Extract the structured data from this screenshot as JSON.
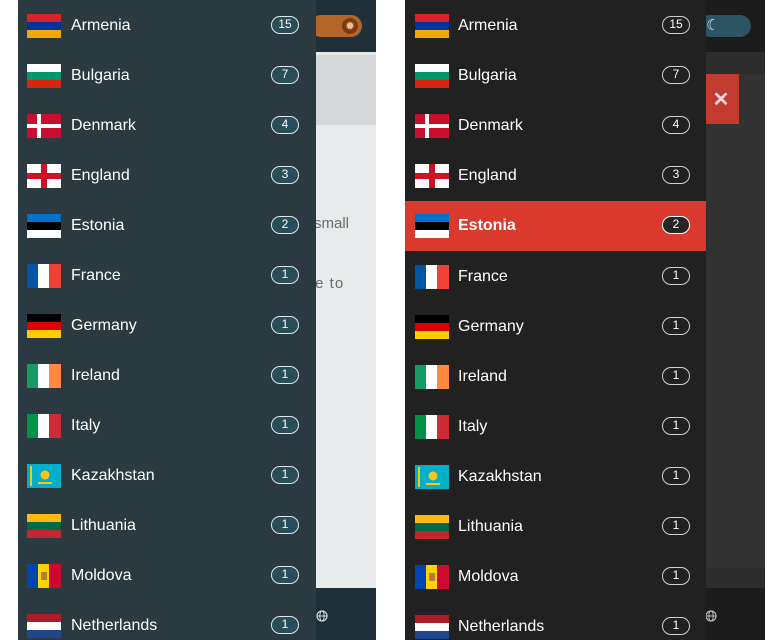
{
  "left_panel": {
    "theme": "teal",
    "background_text": {
      "line1": "small",
      "line2": "te to"
    },
    "countries": [
      {
        "name": "Armenia",
        "count": "15",
        "flag": "armenia"
      },
      {
        "name": "Bulgaria",
        "count": "7",
        "flag": "bulgaria"
      },
      {
        "name": "Denmark",
        "count": "4",
        "flag": "denmark"
      },
      {
        "name": "England",
        "count": "3",
        "flag": "england"
      },
      {
        "name": "Estonia",
        "count": "2",
        "flag": "estonia"
      },
      {
        "name": "France",
        "count": "1",
        "flag": "france"
      },
      {
        "name": "Germany",
        "count": "1",
        "flag": "germany"
      },
      {
        "name": "Ireland",
        "count": "1",
        "flag": "ireland"
      },
      {
        "name": "Italy",
        "count": "1",
        "flag": "italy"
      },
      {
        "name": "Kazakhstan",
        "count": "1",
        "flag": "kazakhstan"
      },
      {
        "name": "Lithuania",
        "count": "1",
        "flag": "lithuania"
      },
      {
        "name": "Moldova",
        "count": "1",
        "flag": "moldova"
      },
      {
        "name": "Netherlands",
        "count": "1",
        "flag": "netherlands"
      }
    ]
  },
  "right_panel": {
    "theme": "dark",
    "selected": "Estonia",
    "close_glyph": "✕",
    "countries": [
      {
        "name": "Armenia",
        "count": "15",
        "flag": "armenia"
      },
      {
        "name": "Bulgaria",
        "count": "7",
        "flag": "bulgaria"
      },
      {
        "name": "Denmark",
        "count": "4",
        "flag": "denmark"
      },
      {
        "name": "England",
        "count": "3",
        "flag": "england"
      },
      {
        "name": "Estonia",
        "count": "2",
        "flag": "estonia"
      },
      {
        "name": "France",
        "count": "1",
        "flag": "france"
      },
      {
        "name": "Germany",
        "count": "1",
        "flag": "germany"
      },
      {
        "name": "Ireland",
        "count": "1",
        "flag": "ireland"
      },
      {
        "name": "Italy",
        "count": "1",
        "flag": "italy"
      },
      {
        "name": "Kazakhstan",
        "count": "1",
        "flag": "kazakhstan"
      },
      {
        "name": "Lithuania",
        "count": "1",
        "flag": "lithuania"
      },
      {
        "name": "Moldova",
        "count": "1",
        "flag": "moldova"
      },
      {
        "name": "Netherlands",
        "count": "1",
        "flag": "netherlands"
      }
    ]
  },
  "colors": {
    "active_row": "#d93a2d",
    "teal_drawer": "#2a3a40",
    "dark_drawer": "#212121",
    "badge_teal": "#2a4d5a"
  },
  "icons": {
    "theme_light": "sun-icon",
    "theme_dark": "moon-icon",
    "footer": "globe-icon",
    "close": "close-icon"
  }
}
